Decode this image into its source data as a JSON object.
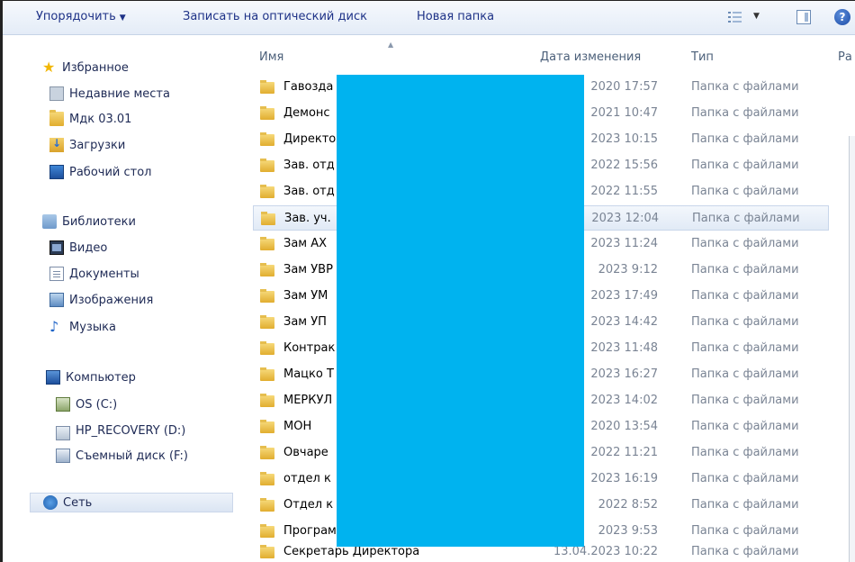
{
  "toolbar": {
    "organize_label": "Упорядочить",
    "organize_arrow": "▼",
    "burn_label": "Записать на оптический диск",
    "new_folder_label": "Новая папка",
    "view_arrow": "▼",
    "help_label": "?"
  },
  "nav": {
    "favorites": {
      "label": "Избранное",
      "items": [
        {
          "label": "Недавние места",
          "icon": "recent-places-icon"
        },
        {
          "label": "Мдк 03.01",
          "icon": "folder-icon"
        },
        {
          "label": "Загрузки",
          "icon": "downloads-icon"
        },
        {
          "label": "Рабочий стол",
          "icon": "desktop-icon"
        }
      ]
    },
    "libraries": {
      "label": "Библиотеки",
      "items": [
        {
          "label": "Видео",
          "icon": "video-icon"
        },
        {
          "label": "Документы",
          "icon": "documents-icon"
        },
        {
          "label": "Изображения",
          "icon": "images-icon"
        },
        {
          "label": "Музыка",
          "icon": "music-icon"
        }
      ]
    },
    "computer": {
      "label": "Компьютер",
      "items": [
        {
          "label": "OS (C:)",
          "icon": "os-drive-icon"
        },
        {
          "label": "HP_RECOVERY (D:)",
          "icon": "drive-icon"
        },
        {
          "label": "Съемный диск (F:)",
          "icon": "removable-drive-icon"
        }
      ]
    },
    "network": {
      "label": "Сеть"
    }
  },
  "columns": {
    "name": "Имя",
    "date": "Дата изменения",
    "type": "Тип",
    "size": "Ра"
  },
  "files": [
    {
      "name": "Гавозда",
      "date": "2020 17:57",
      "type": "Папка с файлами"
    },
    {
      "name": "Демонс",
      "date": "2021 10:47",
      "type": "Папка с файлами"
    },
    {
      "name": "Директо",
      "date": "2023 10:15",
      "type": "Папка с файлами"
    },
    {
      "name": "Зав. отд",
      "date": "2022 15:56",
      "type": "Папка с файлами"
    },
    {
      "name": "Зав. отд",
      "date": "2022 11:55",
      "type": "Папка с файлами"
    },
    {
      "name": "Зав. уч.",
      "date": "2023 12:04",
      "type": "Папка с файлами"
    },
    {
      "name": "Зам АХ",
      "date": "2023 11:24",
      "type": "Папка с файлами"
    },
    {
      "name": "Зам УВР",
      "date": "2023 9:12",
      "type": "Папка с файлами"
    },
    {
      "name": "Зам УМ",
      "date": "2023 17:49",
      "type": "Папка с файлами"
    },
    {
      "name": "Зам УП",
      "date": "2023 14:42",
      "type": "Папка с файлами"
    },
    {
      "name": "Контрак",
      "date": "2023 11:48",
      "type": "Папка с файлами"
    },
    {
      "name": "Мацко Т",
      "date": "2023 16:27",
      "type": "Папка с файлами"
    },
    {
      "name": "МЕРКУЛ",
      "date": "2023 14:02",
      "type": "Папка с файлами"
    },
    {
      "name": "МОН",
      "date": "2020 13:54",
      "type": "Папка с файлами"
    },
    {
      "name": "Овчаре",
      "date": "2022 11:21",
      "type": "Папка с файлами"
    },
    {
      "name": "отдел к",
      "date": "2023 16:19",
      "type": "Папка с файлами"
    },
    {
      "name": "Отдел к",
      "date": "2022 8:52",
      "type": "Папка с файлами"
    },
    {
      "name": "Програм",
      "date": "2023 9:53",
      "type": "Папка с файлами"
    },
    {
      "name": "Секретарь Директора",
      "date": "13.04.2023 10:22",
      "type": "Папка с файлами"
    }
  ]
}
